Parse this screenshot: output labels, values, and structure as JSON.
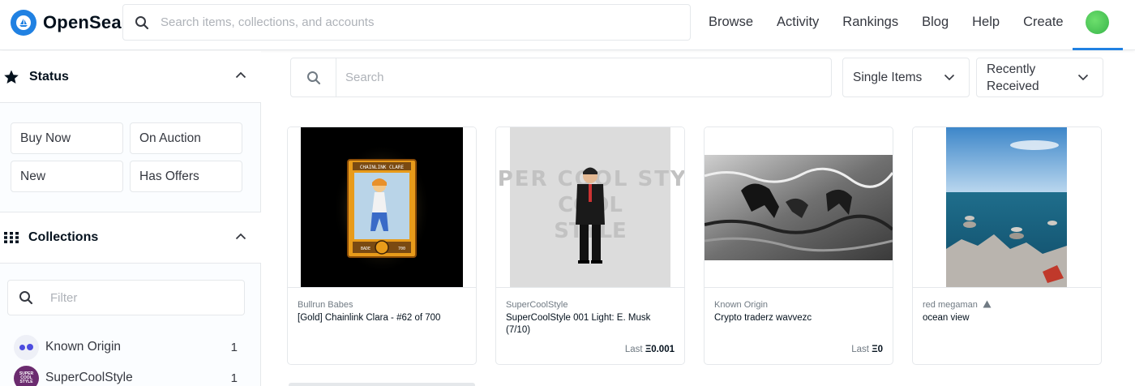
{
  "header": {
    "brand": "OpenSea",
    "search_placeholder": "Search items, collections, and accounts",
    "nav": [
      "Browse",
      "Activity",
      "Rankings",
      "Blog",
      "Help",
      "Create"
    ]
  },
  "sidebar": {
    "status_title": "Status",
    "status_buttons": [
      "Buy Now",
      "On Auction",
      "New",
      "Has Offers"
    ],
    "collections_title": "Collections",
    "filter_placeholder": "Filter",
    "collections": [
      {
        "name": "Known Origin",
        "count": "1"
      },
      {
        "name": "SuperCoolStyle",
        "count": "1"
      }
    ]
  },
  "toolbar": {
    "search_placeholder": "Search",
    "item_type": "Single Items",
    "sort": "Recently Received"
  },
  "cards": [
    {
      "collection": "Bullrun Babes",
      "title": "[Gold] Chainlink Clara - #62 of 700",
      "price_label": "",
      "price_value": "",
      "art_caption": "CHAINLINK CLARE",
      "art_rarity": "BADE",
      "art_number": "700"
    },
    {
      "collection": "SuperCoolStyle",
      "title": "SuperCoolStyle 001 Light: E. Musk (7/10)",
      "price_label": "Last",
      "price_value": "Ξ0.001",
      "art_caption": "SUPER COOL STYLE"
    },
    {
      "collection": "Known Origin",
      "title": "Crypto traderz wavvezc",
      "price_label": "Last",
      "price_value": "Ξ0"
    },
    {
      "collection": "red megaman",
      "title": "ocean view",
      "price_label": "",
      "price_value": ""
    }
  ],
  "colors": {
    "accent": "#2081e2",
    "text": "#353840",
    "border": "#e5e8eb"
  }
}
